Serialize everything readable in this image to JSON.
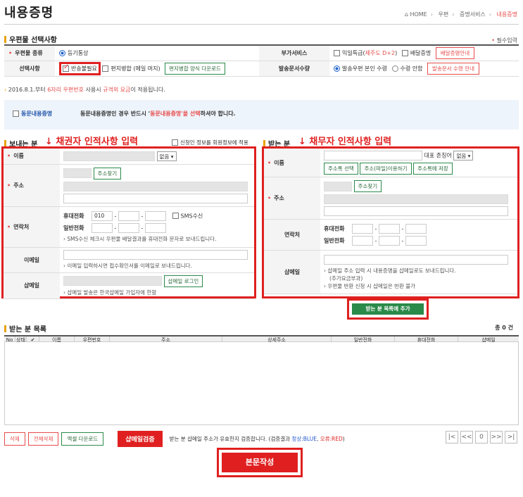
{
  "page": {
    "title": "내용증명",
    "breadcrumb": [
      "HOME",
      "우편",
      "증명서비스",
      "내용증명"
    ]
  },
  "options": {
    "section_title": "우편물 선택사항",
    "required_note": "필수입력",
    "mail_type_label": "우편물 종류",
    "mail_type_value": "등기통상",
    "selection_label": "선택사항",
    "opt_return": "반송불필요",
    "opt_merge": "편지병합 (메일 머지)",
    "merge_download_btn": "편지병합 양식 다운로드",
    "extra_label": "부가서비스",
    "extra_next_day": "익일특급(",
    "extra_jeju": "제주도 D+2",
    "extra_next_day_end": ")",
    "extra_delivery": "배달증명",
    "delivery_info_btn": "배달증명안내",
    "qty_label": "발송문서수량",
    "qty_opt1": "발송우편 본인 수령",
    "qty_opt2": "수령 안함",
    "qty_info_btn": "발송문서 수령 안내"
  },
  "notice": {
    "prefix": "2016.8.1.부터 ",
    "six": "6자리 우편번호",
    "mid": " 사용시 ",
    "outside": "규격외 요금",
    "suffix": "이 적용됩니다."
  },
  "dong": {
    "label": "동문내용증명",
    "text_pre": "동문내용증명인 경우 반드시 '",
    "text_red": "동문내용증명'을 선택",
    "text_post": "하셔야 합니다."
  },
  "sender": {
    "title": "보내는 분",
    "annotation": "↓ 채권자 인적사항 입력",
    "save_info": "신청인 정보를 회원정보에 적용",
    "name_label": "이름",
    "name_select": "없음",
    "addr_label": "주소",
    "addr_btn": "주소찾기",
    "contact_label": "연락처",
    "mobile_label": "휴대전화",
    "mobile_prefix": "010",
    "sms_label": "SMS수신",
    "phone_label": "일반전화",
    "sms_hint": "SMS수신 체크시 우편물 배달결과를 휴대전화 문자로 보내드립니다.",
    "email_label": "이메일",
    "email_hint": "이메일 입력하시면 접수확인서를 이메일로 보내드립니다.",
    "semail_label": "샵메일",
    "semail_btn": "샵메일 로그인",
    "semail_hint": "샵메일 발송은 한국샵메일 가입자에 한함"
  },
  "receiver": {
    "title": "받는 분",
    "annotation": "↓ 채무자 인적사항 입력",
    "name_label": "이름",
    "rep_label": "대표 존칭어",
    "rep_select": "없음",
    "btn_addr_select": "주소록 선택",
    "btn_file": "주소(파일)이용하기",
    "btn_save_addr": "주소록에 저장",
    "addr_label": "주소",
    "addr_btn": "주소찾기",
    "contact_label": "연락처",
    "mobile_label": "휴대전화",
    "phone_label": "일반전화",
    "semail_label": "샵메일",
    "semail_hint1": "샵메일 주소 입력 시 내용증명을 샵메일로도 보내드립니다.",
    "semail_hint2": "(추가요금부과)",
    "semail_hint3": "우편물 반환 신청 시 샵메일은 반환 불가",
    "add_btn": "받는 분 목록에 추가"
  },
  "list": {
    "title": "받는 분 목록",
    "total": "총 0 건",
    "columns": [
      "No",
      "상태",
      "✔",
      "이름",
      "우편번호",
      "주소",
      "상세주소",
      "일반전화",
      "휴대전화",
      "샵메일"
    ]
  },
  "bottom": {
    "delete": "삭제",
    "delete_all": "전체삭제",
    "excel": "엑셀 다운로드",
    "semail_check": "샵메일검증",
    "check_note_pre": "받는 분 샵메일 주소가 유효한지 검증합니다. (검증결과 ",
    "check_ok": "정상:BLUE",
    "check_sep": ", ",
    "check_err": "오류:RED",
    "check_note_post": ")",
    "page_num": "0",
    "write_btn": "본문작성"
  }
}
